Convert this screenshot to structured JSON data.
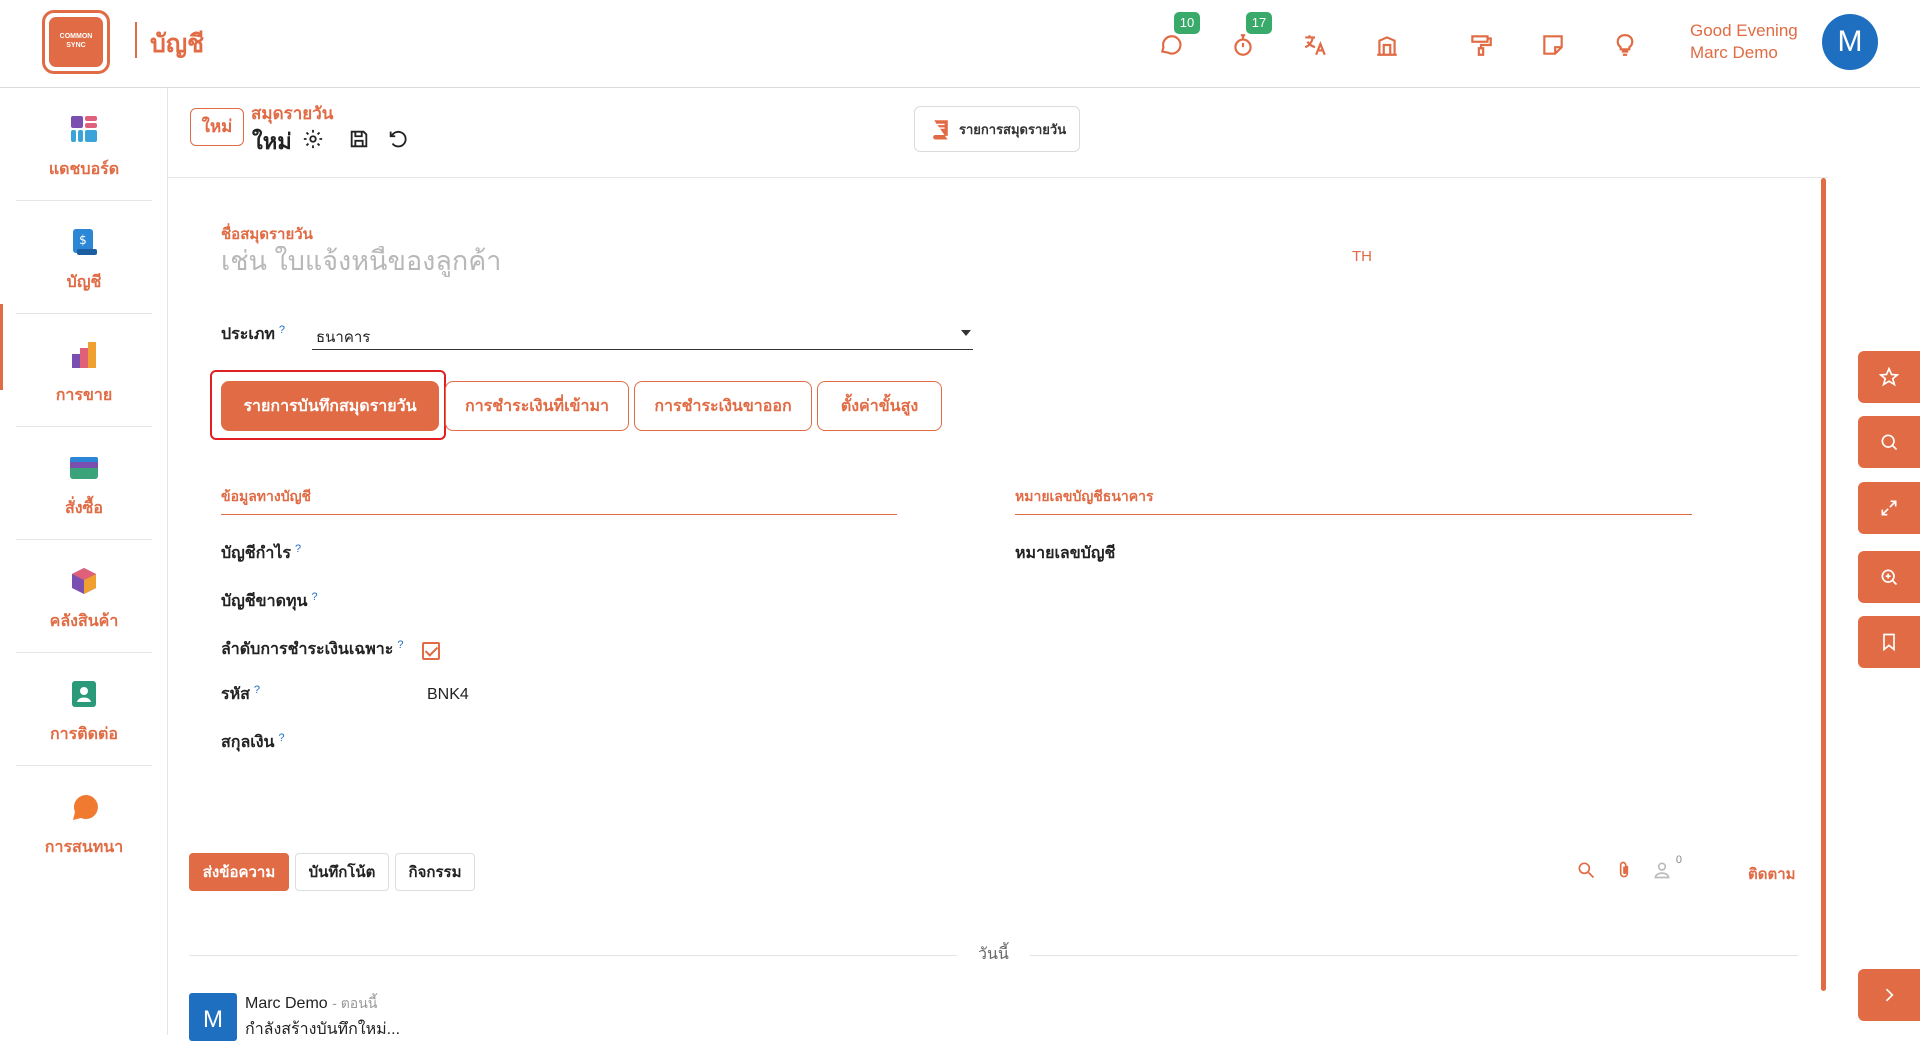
{
  "header": {
    "logo_text": "COMMON SYNC",
    "app_title": "บัญชี",
    "messages_count": "10",
    "activities_count": "17",
    "greeting": "Good Evening",
    "user_name": "Marc Demo",
    "user_initial": "M"
  },
  "sidebar": {
    "items": [
      {
        "label": "แดชบอร์ด"
      },
      {
        "label": "บัญชี"
      },
      {
        "label": "การขาย"
      },
      {
        "label": "สั่งซื้อ"
      },
      {
        "label": "คลังสินค้า"
      },
      {
        "label": "การติดต่อ"
      },
      {
        "label": "การสนทนา"
      }
    ]
  },
  "page": {
    "new_tag": "ใหม่",
    "breadcrumb_parent": "สมุดรายวัน",
    "breadcrumb_current": "ใหม่",
    "journal_list_button": "รายการสมุดรายวัน"
  },
  "form": {
    "name_caption": "ชื่อสมุดรายวัน",
    "name_placeholder": "เช่น ใบแจ้งหนี้ของลูกค้า",
    "lang": "TH",
    "type_label": "ประเภท",
    "type_value": "ธนาคาร",
    "help_mark": "?",
    "tabs": [
      "รายการบันทึกสมุดรายวัน",
      "การชำระเงินที่เข้ามา",
      "การชำระเงินขาออก",
      "ตั้งค่าขั้นสูง"
    ],
    "section_accounting": "ข้อมูลทางบัญชี",
    "section_bank": "หมายเลขบัญชีธนาคาร",
    "profit_account": "บัญชีกำไร",
    "loss_account": "บัญชีขาดทุน",
    "dedicated_payment_sequence": "ลำดับการชำระเงินเฉพาะ",
    "dedicated_payment_sequence_checked": true,
    "code_label": "รหัส",
    "code_value": "BNK4",
    "currency_label": "สกุลเงิน",
    "account_number_label": "หมายเลขบัญชี"
  },
  "chatter": {
    "send_message": "ส่งข้อความ",
    "log_note": "บันทึกโน้ต",
    "activity": "กิจกรรม",
    "followers_count": "0",
    "follow": "ติดตาม",
    "day_label": "วันนี้",
    "message": {
      "initial": "M",
      "author": "Marc Demo",
      "time": "- ตอนนี้",
      "body": "กำลังสร้างบันทึกใหม่..."
    }
  },
  "colors": {
    "accent": "#e06b44",
    "badge": "#3aaa6b",
    "avatar": "#1f6fc1",
    "highlight": "#e02020"
  }
}
